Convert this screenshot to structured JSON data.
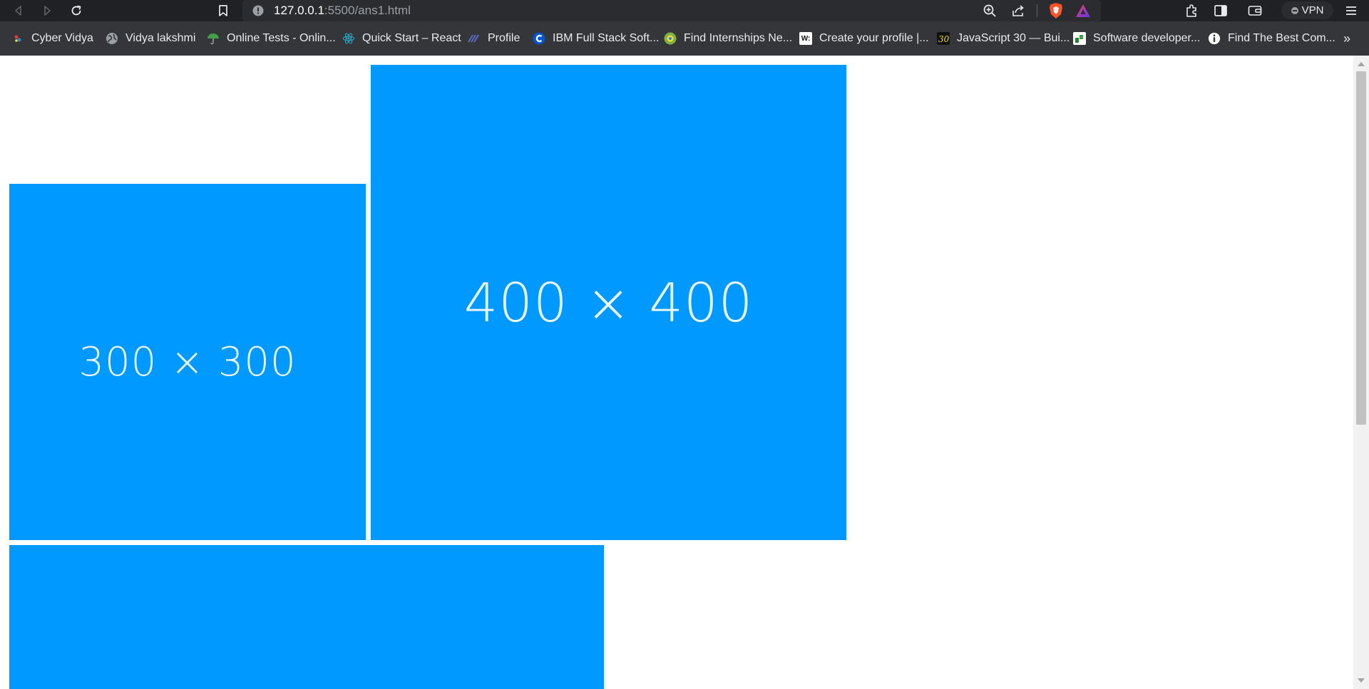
{
  "address_bar": {
    "host": "127.0.0.1",
    "path": ":5500/ans1.html"
  },
  "toolbar": {
    "vpn_label": "VPN"
  },
  "bookmarks": [
    {
      "label": "Cyber Vidya",
      "icon": "cyber-vidya-icon"
    },
    {
      "label": "Vidya lakshmi",
      "icon": "globe-icon"
    },
    {
      "label": "Online Tests - Onlin...",
      "icon": "umbrella-icon"
    },
    {
      "label": "Quick Start – React",
      "icon": "react-icon"
    },
    {
      "label": "Profile",
      "icon": "profile-icon"
    },
    {
      "label": "IBM Full Stack Soft...",
      "icon": "coursera-icon"
    },
    {
      "label": "Find Internships Ne...",
      "icon": "internshala-icon"
    },
    {
      "label": "Create your profile |...",
      "icon": "w-icon"
    },
    {
      "label": "JavaScript 30 — Bui...",
      "icon": "js30-icon"
    },
    {
      "label": "Software developer...",
      "icon": "naukri-icon"
    },
    {
      "label": "Find The Best Com...",
      "icon": "info-icon"
    }
  ],
  "placeholders": [
    {
      "label": "300 × 300",
      "color": "#0099ff"
    },
    {
      "label": "400 × 400",
      "color": "#0099ff"
    },
    {
      "label": "",
      "color": "#0099ff"
    }
  ],
  "colors": {
    "toolbar_bg": "#202124",
    "bookmarks_bg": "#35363a",
    "placeholder_blue": "#0099ff",
    "brave_orange": "#fb542b"
  }
}
